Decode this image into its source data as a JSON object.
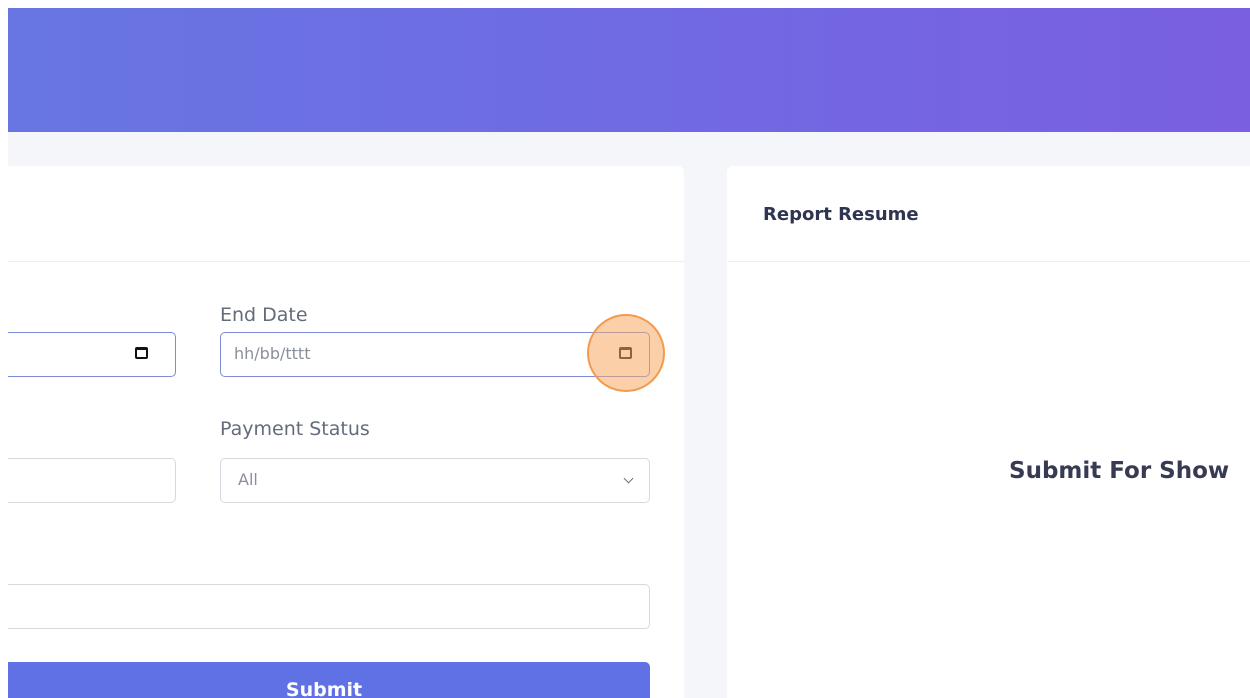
{
  "filter_form": {
    "end_date_label": "End Date",
    "end_date_placeholder": "hh/bb/tttt",
    "payment_status_label": "Payment Status",
    "payment_status_value": "All",
    "submit_label": "Submit"
  },
  "report_panel": {
    "title": "Report Resume",
    "empty_message": "Submit For Show"
  },
  "icons": {
    "date_picker": "calendar-icon",
    "select_arrow": "chevron-down-icon"
  },
  "colors": {
    "header_gradient_start": "#6776e2",
    "header_gradient_end": "#7a5fe0",
    "primary_button": "#5f71e4",
    "click_highlight": "#f7a860"
  }
}
